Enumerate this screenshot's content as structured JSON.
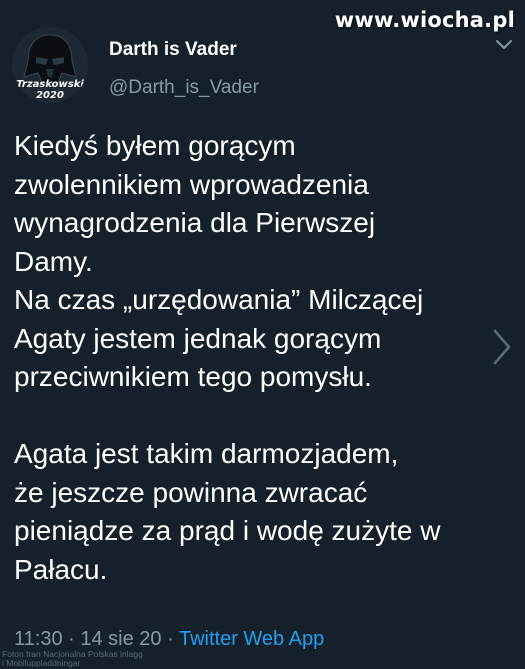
{
  "watermark": "www.wiocha.pl",
  "author": {
    "name": "Darth is Vader",
    "handle": "@Darth_is_Vader",
    "avatar_caption_line1": "Trzaskowski",
    "avatar_caption_line2": "2020"
  },
  "icons": {
    "menu": "chevron-down-icon",
    "next": "chevron-right-icon"
  },
  "tweet": {
    "paragraph1": [
      "Kiedyś byłem gorącym",
      "zwolennikiem wprowadzenia",
      "wynagrodzenia dla Pierwszej",
      "Damy.",
      "Na czas „urzędowania” Milczącej",
      "Agaty jestem jednak gorącym",
      "przeciwnikiem tego pomysłu."
    ],
    "paragraph2": [
      "Agata jest takim darmozjadem,",
      "że jeszcze powinna zwracać",
      "pieniądze za prąd i wodę zużyte w",
      "Pałacu."
    ]
  },
  "meta": {
    "time": "11:30",
    "separator1": " · ",
    "date": "14 sie 20",
    "separator2": " · ",
    "app": "Twitter Web App"
  },
  "photo_credit": {
    "line1": "Foton fran Nacjonalna Polskas inlagg",
    "line2": "i Mobiluppladdningar"
  },
  "colors": {
    "background": "#15202b",
    "text": "#ffffff",
    "secondary": "#8899a6",
    "link": "#1da1f2"
  }
}
